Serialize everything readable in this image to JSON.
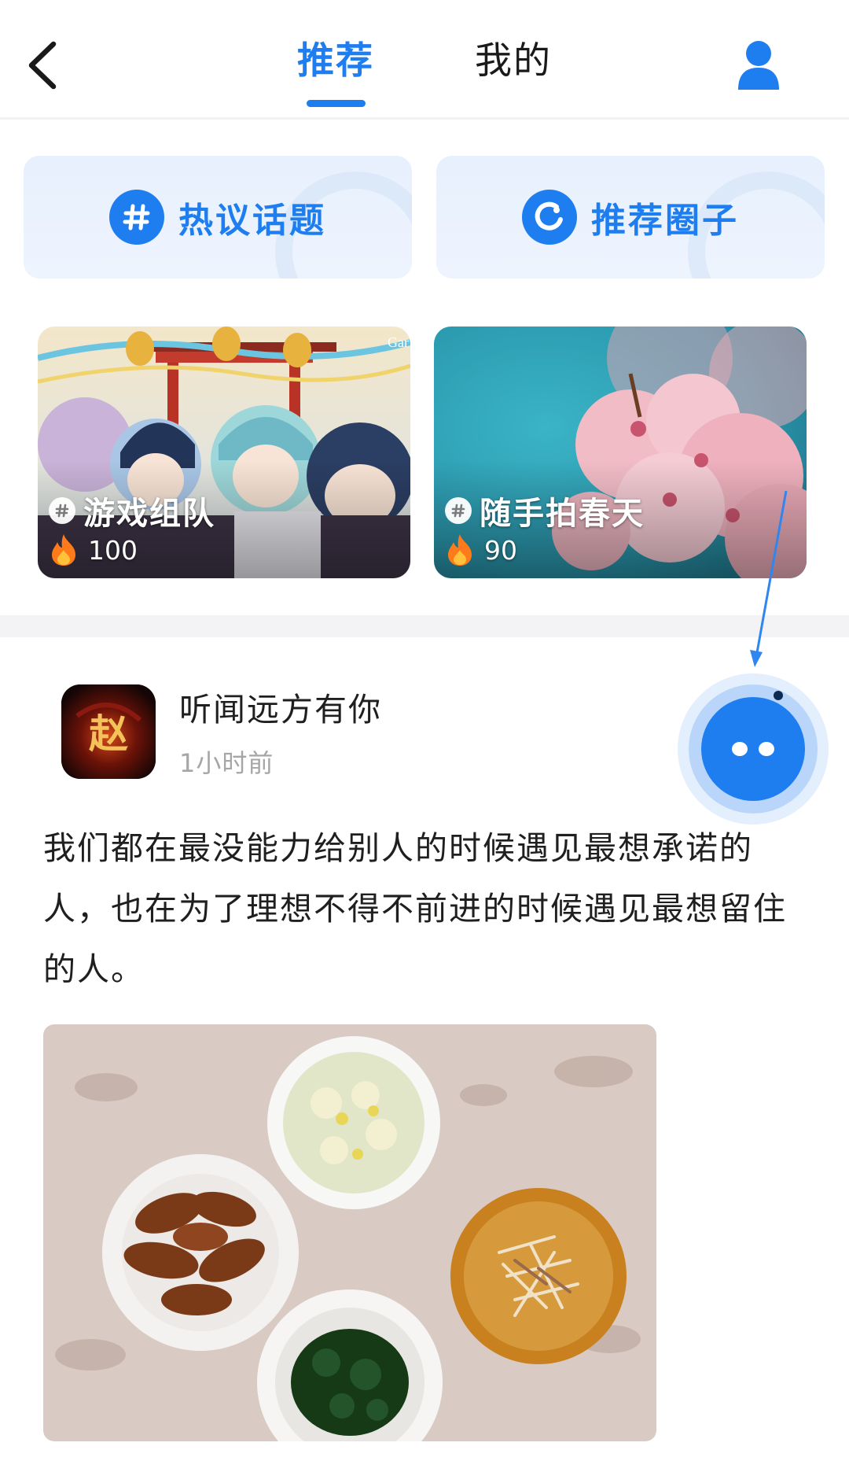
{
  "nav": {
    "back_icon": "chevron-left-icon",
    "tabs": [
      {
        "label": "推荐",
        "active": true
      },
      {
        "label": "我的",
        "active": false
      }
    ],
    "profile_icon": "user-icon"
  },
  "entries": [
    {
      "label": "热议话题",
      "icon": "hashtag-icon"
    },
    {
      "label": "推荐圈子",
      "icon": "circle-icon"
    }
  ],
  "topics": [
    {
      "title": "游戏组队",
      "count": "100",
      "icon": "hashtag-icon",
      "watermark": "Gar"
    },
    {
      "title": "随手拍春天",
      "count": "90",
      "icon": "hashtag-icon"
    }
  ],
  "post": {
    "author": "听闻远方有你",
    "time": "1小时前",
    "avatar_text": "赵",
    "text": "我们都在最没能力给别人的时候遇见最想承诺的人，也在为了理想不得不前进的时候遇见最想留住的人。"
  },
  "assistant": {
    "icon": "assistant-bot-icon"
  },
  "colors": {
    "accent": "#1e7ef0",
    "muted": "#a6a6a6",
    "divider": "#f3f3f5"
  }
}
